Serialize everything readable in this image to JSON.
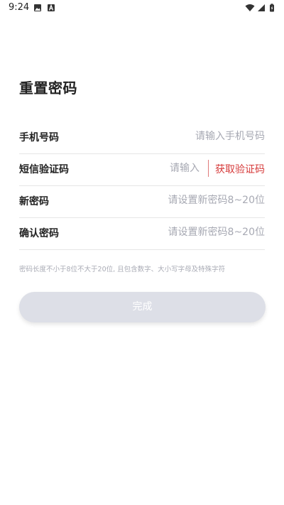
{
  "status_bar": {
    "time": "9:24"
  },
  "page": {
    "title": "重置密码"
  },
  "form": {
    "phone": {
      "label": "手机号码",
      "placeholder": "请输入手机号码",
      "value": ""
    },
    "code": {
      "label": "短信验证码",
      "placeholder": "请输入",
      "value": "",
      "get_code_label": "获取验证码"
    },
    "new_password": {
      "label": "新密码",
      "placeholder": "请设置新密码8~20位",
      "value": ""
    },
    "confirm_password": {
      "label": "确认密码",
      "placeholder": "请设置新密码8~20位",
      "value": ""
    },
    "hint": "密码长度不小于8位不大于20位, 且包含数字、大小写字母及特殊字符",
    "submit_label": "完成"
  },
  "colors": {
    "accent": "#d63a3a",
    "button_disabled": "#dddfe7",
    "placeholder": "#a7a9b3"
  }
}
